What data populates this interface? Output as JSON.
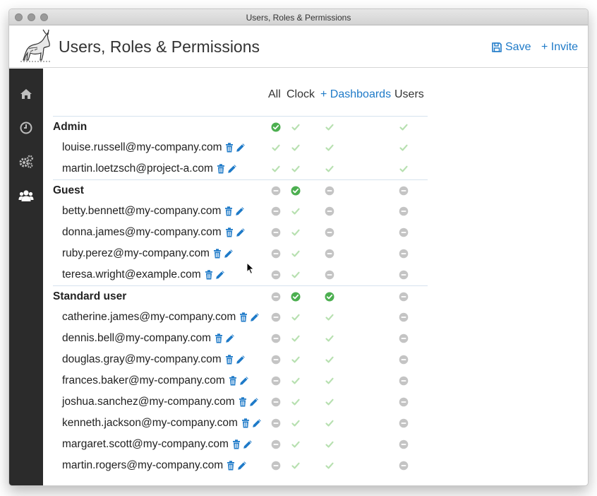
{
  "window": {
    "title": "Users, Roles & Permissions"
  },
  "header": {
    "title": "Users, Roles & Permissions",
    "save_label": "Save",
    "invite_label": "+ Invite"
  },
  "sidebar": {
    "items": [
      {
        "icon": "home-icon"
      },
      {
        "icon": "clock-icon"
      },
      {
        "icon": "gears-icon"
      },
      {
        "icon": "users-icon",
        "active": true
      }
    ]
  },
  "columns": [
    "All",
    "Clock",
    "+ Dashboards",
    "Users"
  ],
  "colors": {
    "accent": "#1e7ac8",
    "granted": "#4caf50",
    "inherited": "#b7e0b0",
    "denied": "#c4c4c4",
    "sidebar": "#2b2b2b"
  },
  "rows": [
    {
      "type": "group",
      "label": "Admin",
      "perms": [
        "granted",
        "inherited",
        "inherited",
        "inherited"
      ]
    },
    {
      "type": "user",
      "label": "louise.russell@my-company.com",
      "perms": [
        "inherited",
        "inherited",
        "inherited",
        "inherited"
      ]
    },
    {
      "type": "user",
      "label": "martin.loetzsch@project-a.com",
      "perms": [
        "inherited",
        "inherited",
        "inherited",
        "inherited"
      ]
    },
    {
      "type": "group",
      "label": "Guest",
      "perms": [
        "denied",
        "granted",
        "denied",
        "denied"
      ]
    },
    {
      "type": "user",
      "label": "betty.bennett@my-company.com",
      "perms": [
        "denied",
        "inherited",
        "denied",
        "denied"
      ]
    },
    {
      "type": "user",
      "label": "donna.james@my-company.com",
      "perms": [
        "denied",
        "inherited",
        "denied",
        "denied"
      ]
    },
    {
      "type": "user",
      "label": "ruby.perez@my-company.com",
      "perms": [
        "denied",
        "inherited",
        "denied",
        "denied"
      ]
    },
    {
      "type": "user",
      "label": "teresa.wright@example.com",
      "perms": [
        "denied",
        "inherited",
        "denied",
        "denied"
      ]
    },
    {
      "type": "group",
      "label": "Standard user",
      "perms": [
        "denied",
        "granted",
        "granted",
        "denied"
      ]
    },
    {
      "type": "user",
      "label": "catherine.james@my-company.com",
      "perms": [
        "denied",
        "inherited",
        "inherited",
        "denied"
      ]
    },
    {
      "type": "user",
      "label": "dennis.bell@my-company.com",
      "perms": [
        "denied",
        "inherited",
        "inherited",
        "denied"
      ]
    },
    {
      "type": "user",
      "label": "douglas.gray@my-company.com",
      "perms": [
        "denied",
        "inherited",
        "inherited",
        "denied"
      ]
    },
    {
      "type": "user",
      "label": "frances.baker@my-company.com",
      "perms": [
        "denied",
        "inherited",
        "inherited",
        "denied"
      ]
    },
    {
      "type": "user",
      "label": "joshua.sanchez@my-company.com",
      "perms": [
        "denied",
        "inherited",
        "inherited",
        "denied"
      ]
    },
    {
      "type": "user",
      "label": "kenneth.jackson@my-company.com",
      "perms": [
        "denied",
        "inherited",
        "inherited",
        "denied"
      ]
    },
    {
      "type": "user",
      "label": "margaret.scott@my-company.com",
      "perms": [
        "denied",
        "inherited",
        "inherited",
        "denied"
      ]
    },
    {
      "type": "user",
      "label": "martin.rogers@my-company.com",
      "perms": [
        "denied",
        "inherited",
        "inherited",
        "denied"
      ]
    }
  ]
}
